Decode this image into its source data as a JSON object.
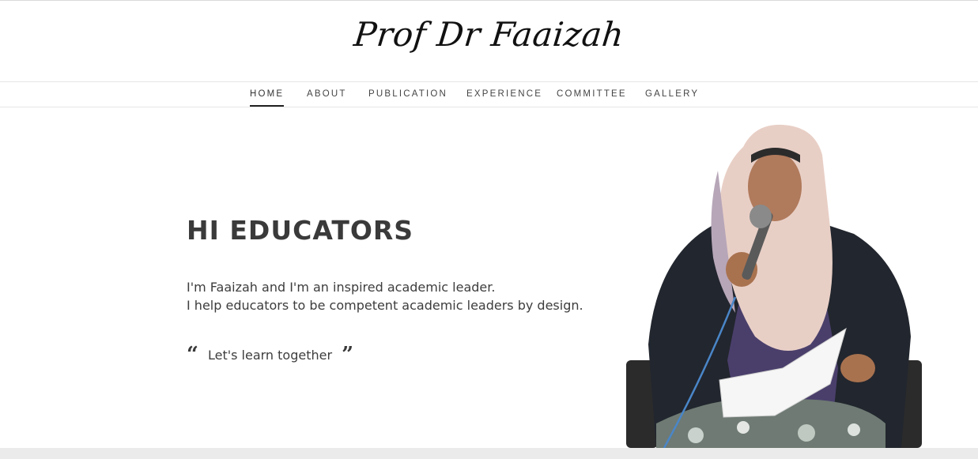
{
  "site": {
    "title": "Prof Dr Faaizah"
  },
  "nav": {
    "items": [
      {
        "label": "HOME",
        "active": true
      },
      {
        "label": "ABOUT",
        "active": false
      },
      {
        "label": "PUBLICATION",
        "active": false
      },
      {
        "label": "EXPERIENCE",
        "active": false
      },
      {
        "label": "COMMITTEE",
        "active": false
      },
      {
        "label": "GALLERY",
        "active": false
      }
    ]
  },
  "hero": {
    "heading": "HI EDUCATORS",
    "intro_line1": "I'm Faaizah and I'm an inspired academic leader.",
    "intro_line2": "I help educators to be competent academic leaders by design.",
    "quote_open": "“",
    "quote": "Let's learn together",
    "quote_close": "”"
  },
  "colors": {
    "text": "#3a3a3a",
    "nav_active_underline": "#222222",
    "footer_band": "#ebebeb",
    "jacket": "#22262e",
    "hijab": "#e8cfc6"
  }
}
